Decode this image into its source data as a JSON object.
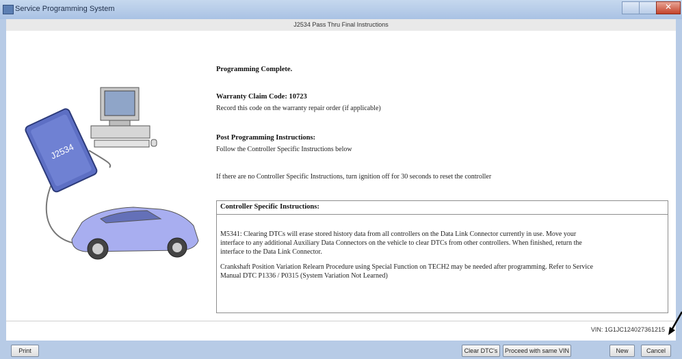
{
  "window": {
    "title": "Service Programming System",
    "subtitle": "J2534 Pass Thru Final Instructions"
  },
  "illustration": {
    "device_label": "J2534"
  },
  "content": {
    "heading": "Programming Complete.",
    "warranty_label": "Warranty Claim Code: 10723",
    "warranty_text": "Record this code on the warranty repair order (if applicable)",
    "post_heading": "Post Programming Instructions:",
    "post_text": "Follow the Controller Specific Instructions below",
    "ignition_text": "If there are no Controller Specific Instructions, turn ignition off for 30 seconds to reset the controller"
  },
  "controller_box": {
    "heading": "Controller Specific Instructions:",
    "p1_line1": "M5341: Clearing DTCs will erase stored history data from all controllers on the Data Link Connector currently in use. Move your",
    "p1_line2": "interface to any additional Auxiliary Data Connectors on the vehicle to clear DTCs from other controllers. When finished, return the",
    "p1_line3": "interface to the Data Link Connector.",
    "p2_line1": "Crankshaft Position Variation Relearn Procedure using Special Function on TECH2 may be needed after programming. Refer to Service",
    "p2_line2": "Manual DTC P1336 / P0315 (System Variation Not Learned)"
  },
  "status": {
    "vin": "VIN: 1G1JC124027361215"
  },
  "buttons": {
    "print": "Print",
    "clear_dtcs": "Clear DTC's",
    "proceed_vin": "Proceed with same VIN",
    "new": "New",
    "cancel": "Cancel"
  },
  "colors": {
    "car": "#a8aef0",
    "device": "#5d6fc4",
    "frame": "#b7cbe6"
  }
}
